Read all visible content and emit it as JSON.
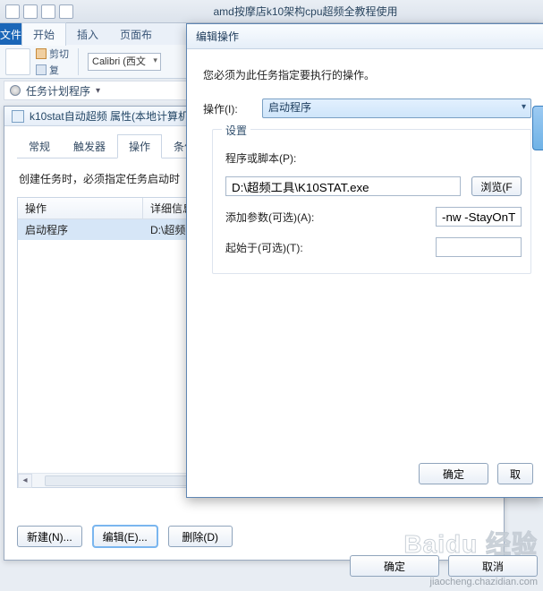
{
  "titlebar": {
    "title": "amd按摩店k10架构cpu超频全教程使用"
  },
  "ribbon": {
    "file": "文件",
    "tabs": [
      "开始",
      "插入",
      "页面布"
    ],
    "clipboard": {
      "cut": "剪切",
      "copy": "复"
    },
    "font_select": "Calibri (西文"
  },
  "sched_header": {
    "label": "任务计划程序"
  },
  "props": {
    "title": "k10stat自动超频 属性(本地计算机",
    "tabs": {
      "general": "常规",
      "triggers": "触发器",
      "actions": "操作",
      "conditions": "条件"
    },
    "desc": "创建任务时，必须指定任务启动时",
    "list": {
      "col_action": "操作",
      "col_detail": "详细信息",
      "row_action": "启动程序",
      "row_detail": "D:\\超频工"
    },
    "buttons": {
      "new": "新建(N)...",
      "edit": "编辑(E)...",
      "delete": "删除(D)"
    }
  },
  "dialog": {
    "title": "编辑操作",
    "instruction": "您必须为此任务指定要执行的操作。",
    "action_label": "操作(I):",
    "action_value": "启动程序",
    "group_title": "设置",
    "script_label": "程序或脚本(P):",
    "script_value": "D:\\超频工具\\K10STAT.exe",
    "browse": "浏览(F",
    "args_label": "添加参数(可选)(A):",
    "args_value": "-nw -StayOnTray",
    "startin_label": "起始于(可选)(T):",
    "startin_value": "",
    "ok": "确定",
    "cancel": "取"
  },
  "footer": {
    "ok": "确定",
    "cancel": "取消"
  },
  "watermark": {
    "logo": "Baidu 经验",
    "url": "jiaocheng.chazidian.com"
  }
}
